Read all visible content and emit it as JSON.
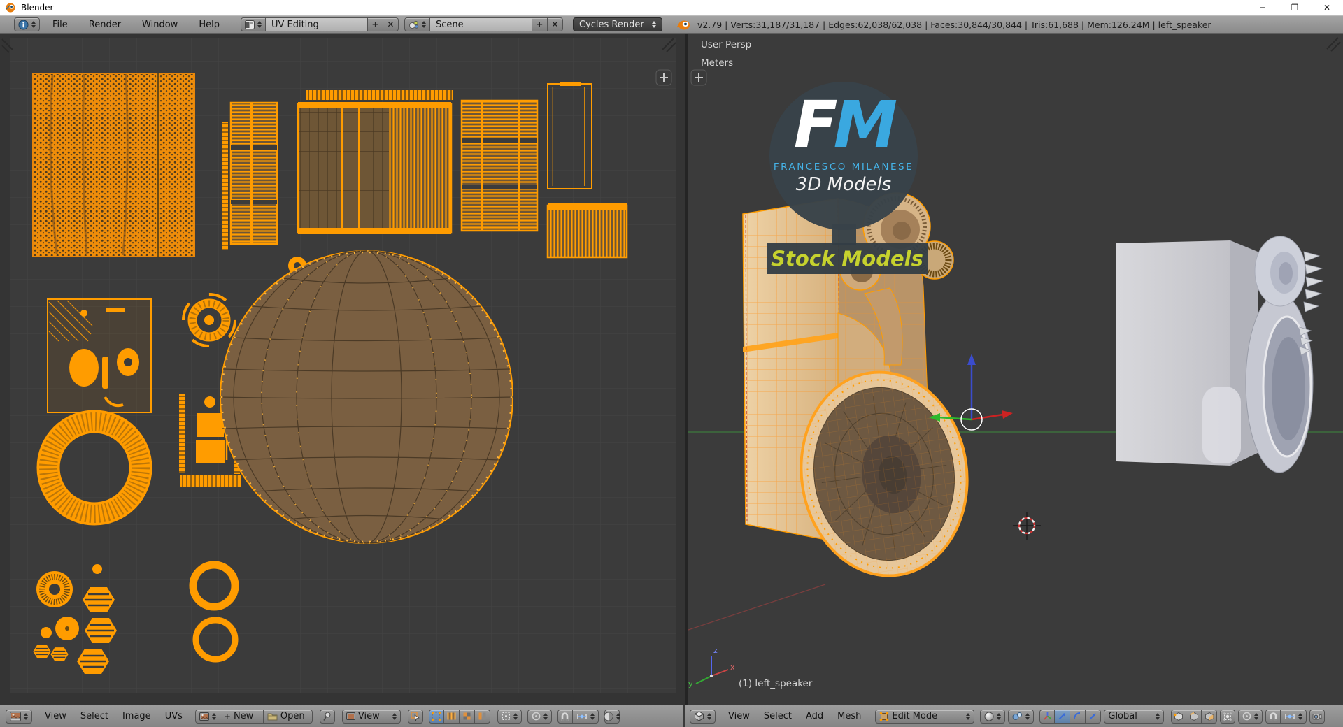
{
  "window": {
    "title": "Blender",
    "minimize": "─",
    "maximize": "❐",
    "close": "✕"
  },
  "glyphs": {
    "plus": "+",
    "x": "✕"
  },
  "topbar": {
    "menu_file": "File",
    "menu_render": "Render",
    "menu_window": "Window",
    "menu_help": "Help",
    "layout_name": "UV Editing",
    "scene_name": "Scene",
    "engine": "Cycles Render",
    "stats": "v2.79 | Verts:31,187/31,187 | Edges:62,038/62,038 | Faces:30,844/30,844 | Tris:61,688 | Mem:126.24M | left_speaker"
  },
  "uv_header": {
    "menu_view": "View",
    "menu_select": "Select",
    "menu_image": "Image",
    "menu_uvs": "UVs",
    "new_button": "New",
    "open_button": "Open",
    "view_dropdown": "View"
  },
  "vp_header": {
    "menu_view": "View",
    "menu_select": "Select",
    "menu_add": "Add",
    "menu_mesh": "Mesh",
    "mode": "Edit Mode",
    "orientation": "Global"
  },
  "viewport": {
    "view_label": "User Persp",
    "units_label": "Meters",
    "object_label": "(1) left_speaker",
    "axis_x": "x",
    "axis_y": "y",
    "axis_z": "z"
  },
  "watermark": {
    "letter_f": "F",
    "letter_m": "M",
    "name": "FRANCESCO MILANESE",
    "subtitle": "3D Models",
    "banner": "Stock Models"
  },
  "colors": {
    "selection_orange": "#ff9c00",
    "uv_face_brown": "#73573b",
    "viewport_bg": "#3b3b3b",
    "fm_blue": "#3aa8e0",
    "banner_yellow": "#c6d22e",
    "axis_x": "#cc3a3a",
    "axis_y": "#2db82d",
    "axis_z": "#3b4ccc",
    "edit_face_tan": "#e0c094"
  }
}
